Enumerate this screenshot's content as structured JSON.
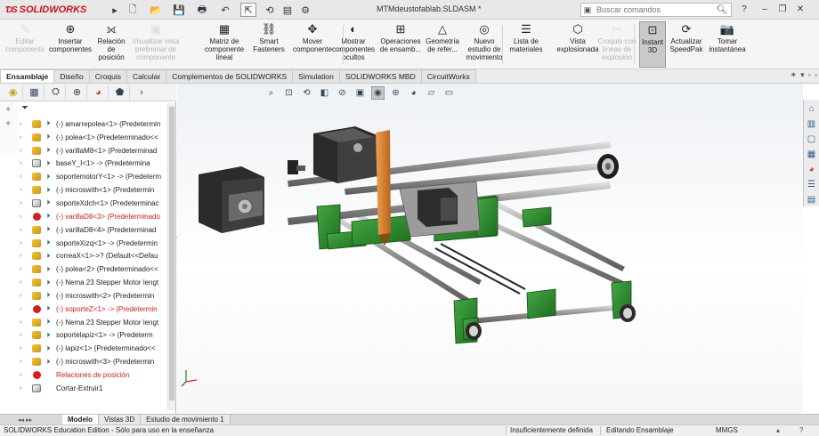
{
  "app": {
    "brand": "SOLIDWORKS",
    "document_title": "MTMdeustofablab.SLDASM *",
    "search_placeholder": "Buscar comandos"
  },
  "ribbon": {
    "items": [
      {
        "label": "Editar\ncomponente",
        "icon": "edit-component-icon",
        "enabled": false
      },
      {
        "label": "Insertar\ncomponentes",
        "icon": "insert-components-icon",
        "enabled": true
      },
      {
        "label": "Relación\nde\nposición",
        "icon": "mate-icon",
        "enabled": true
      },
      {
        "label": "Visualizar vista\npreliminar de\ncomponente",
        "icon": "preview-component-icon",
        "enabled": false
      },
      {
        "label": "Matriz de\ncomponente lineal",
        "icon": "linear-pattern-icon",
        "enabled": true
      },
      {
        "label": "Smart\nFasteners",
        "icon": "smart-fasteners-icon",
        "enabled": true
      },
      {
        "label": "Mover\ncomponente",
        "icon": "move-component-icon",
        "enabled": true
      },
      {
        "label": "Mostrar\ncomponentes\nocultos",
        "icon": "show-hidden-icon",
        "enabled": true
      },
      {
        "label": "Operaciones\nde ensamb...",
        "icon": "assembly-features-icon",
        "enabled": true
      },
      {
        "label": "Geometría\nde refer...",
        "icon": "reference-geometry-icon",
        "enabled": true
      },
      {
        "label": "Nuevo\nestudio de\nmovimiento",
        "icon": "motion-study-icon",
        "enabled": true
      },
      {
        "label": "Lista de\nmateriales",
        "icon": "bom-icon",
        "enabled": true
      },
      {
        "label": "Vista\nexplosionada",
        "icon": "exploded-view-icon",
        "enabled": true
      },
      {
        "label": "Croquis con\nlíneas de\nexplosión",
        "icon": "explode-line-sketch-icon",
        "enabled": false
      },
      {
        "label": "Instant\n3D",
        "icon": "instant3d-icon",
        "enabled": true,
        "active": true
      },
      {
        "label": "Actualizar\nSpeedPak",
        "icon": "speedpak-icon",
        "enabled": true
      },
      {
        "label": "Tomar\ninstantánea",
        "icon": "snapshot-icon",
        "enabled": true
      }
    ]
  },
  "tabs": [
    "Ensamblaje",
    "Diseño",
    "Croquis",
    "Calcular",
    "Complementos de SOLIDWORKS",
    "Simulation",
    "SOLIDWORKS MBD",
    "CircuitWorks"
  ],
  "active_tab": "Ensamblaje",
  "tree": [
    {
      "label": "(-) amarrepolea<1> (Predetermin",
      "icon": "part",
      "error": false
    },
    {
      "label": "(-) polea<1> (Predeterminado<<",
      "icon": "part",
      "error": false
    },
    {
      "label": "(-) varillaM8<1> (Predeterminad",
      "icon": "part",
      "error": false
    },
    {
      "label": "baseY_I<1> -> (Predetermina",
      "icon": "part-fixed",
      "error": false
    },
    {
      "label": "soportemotorY<1> -> (Predeterm",
      "icon": "part",
      "error": false
    },
    {
      "label": "(-) microswith<1> (Predetermin",
      "icon": "part",
      "error": false
    },
    {
      "label": "soporteXdch<1> (Predeterminac",
      "icon": "part-fixed",
      "error": false
    },
    {
      "label": "(-) varillaD8<3> (Predeterminado",
      "icon": "part-error",
      "error": true
    },
    {
      "label": "(-) varillaD8<4> (Predeterminad",
      "icon": "part",
      "error": false
    },
    {
      "label": "soporteXizq<1> -> (Predetermin",
      "icon": "part",
      "error": false
    },
    {
      "label": "correaX<1>->? (Default<<Defau",
      "icon": "part",
      "error": false
    },
    {
      "label": "(-) polea<2> (Predeterminado<<",
      "icon": "part",
      "error": false
    },
    {
      "label": "(-) Nema 23 Stepper Motor lengt",
      "icon": "part",
      "error": false
    },
    {
      "label": "(-) microswith<2> (Predetermin",
      "icon": "part",
      "error": false
    },
    {
      "label": "(-) soporteZ<1> -> (Predetermin",
      "icon": "part-error",
      "error": true
    },
    {
      "label": "(-) Nema 23 Stepper Motor lengt",
      "icon": "part",
      "error": false
    },
    {
      "label": "soportelapiz<1> -> (Predeterm",
      "icon": "part",
      "error": false
    },
    {
      "label": "(-) lapiz<1> (Predeterminado<<",
      "icon": "part",
      "error": false
    },
    {
      "label": "(-) microswith<3> (Predetermin",
      "icon": "part",
      "error": false
    },
    {
      "label": "Relaciones de posición",
      "icon": "mates-error",
      "error": true
    },
    {
      "label": "Cortar-Extruir1",
      "icon": "cut-extrude",
      "error": false
    }
  ],
  "bottom_tabs": [
    "Modelo",
    "Vistas 3D",
    "Estudio de movimiento 1"
  ],
  "active_bottom_tab": "Modelo",
  "status": {
    "edition": "SOLIDWORKS Education Edition - Sólo para uso en la enseñanza",
    "definition": "Insuficientemente definida",
    "mode": "Editando Ensamblaje",
    "units": "MMGS"
  },
  "colors": {
    "brand_red": "#c8141e",
    "part_green": "#2f8f2f",
    "pencil_orange": "#d9822b",
    "error_red": "#c81e1e"
  }
}
